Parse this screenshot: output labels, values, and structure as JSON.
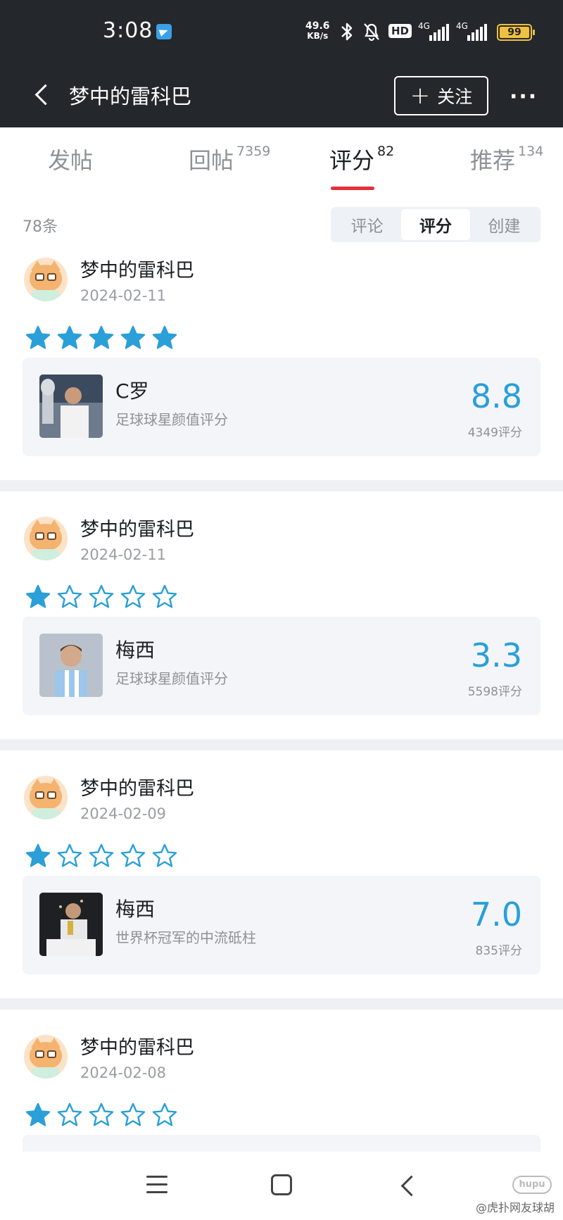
{
  "status_bar": {
    "time": "3:08",
    "net_speed_value": "49.6",
    "net_speed_unit": "KB/s",
    "hd_badge": "HD",
    "sim1": "4G",
    "sim2": "4G",
    "battery": "99"
  },
  "header": {
    "title": "梦中的雷科巴",
    "follow_label": "关注",
    "more_label": "···"
  },
  "tabs": [
    {
      "label": "发帖",
      "count": ""
    },
    {
      "label": "回帖",
      "count": "7359"
    },
    {
      "label": "评分",
      "count": "82"
    },
    {
      "label": "推荐",
      "count": "134"
    }
  ],
  "list_count": "78条",
  "segments": [
    "评论",
    "评分",
    "创建"
  ],
  "items": [
    {
      "user": "梦中的雷科巴",
      "date": "2024-02-11",
      "stars": 5,
      "target": "C罗",
      "subtitle": "足球球星颜值评分",
      "score": "8.8",
      "votes": "4349评分"
    },
    {
      "user": "梦中的雷科巴",
      "date": "2024-02-11",
      "stars": 1,
      "target": "梅西",
      "subtitle": "足球球星颜值评分",
      "score": "3.3",
      "votes": "5598评分"
    },
    {
      "user": "梦中的雷科巴",
      "date": "2024-02-09",
      "stars": 1,
      "target": "梅西",
      "subtitle": "世界杯冠军的中流砥柱",
      "score": "7.0",
      "votes": "835评分"
    },
    {
      "user": "梦中的雷科巴",
      "date": "2024-02-08",
      "stars": 1
    }
  ],
  "watermark": "@虎扑网友球胡",
  "colors": {
    "accent_blue": "#2a9fd8",
    "tab_red": "#e0323a",
    "header_bg": "#24272b"
  }
}
